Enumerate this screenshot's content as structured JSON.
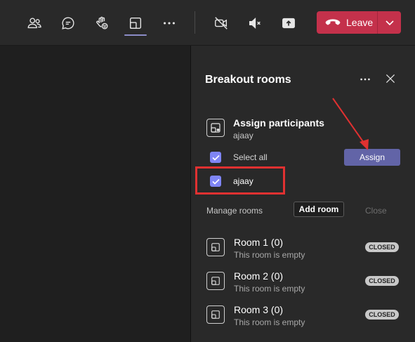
{
  "toolbar": {
    "icons": [
      {
        "name": "people-icon"
      },
      {
        "name": "chat-icon"
      },
      {
        "name": "raise-hand-icon"
      },
      {
        "name": "breakout-rooms-icon",
        "active": true
      },
      {
        "name": "more-actions-icon"
      },
      {
        "name": "camera-off-icon"
      },
      {
        "name": "mute-icon"
      },
      {
        "name": "share-screen-icon"
      }
    ],
    "leave_label": "Leave",
    "leave_color": "#c4314b",
    "active_indicator_color": "#8b8cc7"
  },
  "panel": {
    "title": "Breakout rooms",
    "assign": {
      "title": "Assign participants",
      "subtitle": "ajaay",
      "select_all_label": "Select all",
      "button_label": "Assign",
      "participants": [
        {
          "name": "ajaay",
          "checked": true
        }
      ]
    },
    "manage": {
      "label": "Manage rooms",
      "add_room_label": "Add room",
      "close_label": "Close"
    },
    "rooms": [
      {
        "name": "Room 1 (0)",
        "status": "This room is empty",
        "badge": "CLOSED"
      },
      {
        "name": "Room 2 (0)",
        "status": "This room is empty",
        "badge": "CLOSED"
      },
      {
        "name": "Room 3 (0)",
        "status": "This room is empty",
        "badge": "CLOSED"
      }
    ]
  },
  "colors": {
    "accent": "#6264a7",
    "checkbox": "#7f85f5",
    "annotation": "#e03131"
  }
}
